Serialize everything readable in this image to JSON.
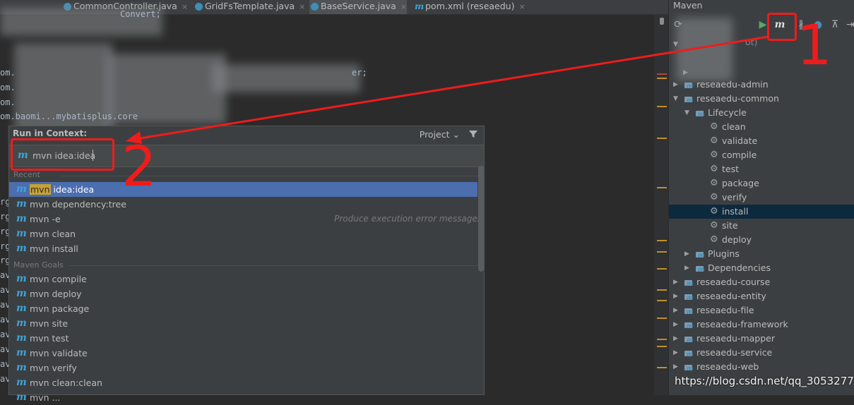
{
  "tabs": [
    {
      "label": "CommonController.java",
      "icon": "class-icon"
    },
    {
      "label": "GridFsTemplate.java",
      "icon": "class-icon"
    },
    {
      "label": "BaseService.java",
      "icon": "class-icon",
      "active": true
    },
    {
      "label": "pom.xml (reseaedu)",
      "icon": "maven-icon"
    }
  ],
  "tab_close": "×",
  "editor": {
    "lines": [
      "Convert;",
      "om.",
      "er;",
      "om.",
      "om.",
      "om.baomi...mybatisplus.core"
    ],
    "gutter_fragments": [
      "rg",
      "rg",
      "rg",
      "rg",
      "rg",
      "rg",
      "av",
      "av",
      "av",
      "av",
      "av",
      "av",
      "av",
      "av",
      "av"
    ]
  },
  "maven": {
    "title": "Maven",
    "root_fragment": "ot)",
    "tree": [
      {
        "label": "reseaedu-admin",
        "level": 0,
        "expanded": false
      },
      {
        "label": "reseaedu-common",
        "level": 0,
        "expanded": true
      },
      {
        "label": "Lifecycle",
        "level": 1,
        "expanded": true
      },
      {
        "label": "clean",
        "level": 2
      },
      {
        "label": "validate",
        "level": 2
      },
      {
        "label": "compile",
        "level": 2
      },
      {
        "label": "test",
        "level": 2
      },
      {
        "label": "package",
        "level": 2
      },
      {
        "label": "verify",
        "level": 2
      },
      {
        "label": "install",
        "level": 2,
        "selected": true
      },
      {
        "label": "site",
        "level": 2
      },
      {
        "label": "deploy",
        "level": 2
      },
      {
        "label": "Plugins",
        "level": 1,
        "expanded": false
      },
      {
        "label": "Dependencies",
        "level": 1,
        "expanded": false
      },
      {
        "label": "reseaedu-course",
        "level": 0,
        "expanded": false
      },
      {
        "label": "reseaedu-entity",
        "level": 0,
        "expanded": false
      },
      {
        "label": "reseaedu-file",
        "level": 0,
        "expanded": false
      },
      {
        "label": "reseaedu-framework",
        "level": 0,
        "expanded": false
      },
      {
        "label": "reseaedu-mapper",
        "level": 0,
        "expanded": false
      },
      {
        "label": "reseaedu-service",
        "level": 0,
        "expanded": false
      },
      {
        "label": "reseaedu-web",
        "level": 0,
        "expanded": false
      }
    ]
  },
  "popup": {
    "title": "Run in Context:",
    "project_label": "Project",
    "input_value": "mvn idea:idea",
    "recent_label": "Recent",
    "goals_label": "Maven Goals",
    "recent": [
      {
        "prefix": "mvn",
        "rest": " idea:idea",
        "selected": true
      },
      {
        "prefix": "",
        "rest": "mvn dependency:tree"
      },
      {
        "prefix": "",
        "rest": "mvn -e",
        "hint": "Produce execution error messages"
      },
      {
        "prefix": "",
        "rest": "mvn clean"
      },
      {
        "prefix": "",
        "rest": "mvn install"
      }
    ],
    "goals": [
      "mvn compile",
      "mvn deploy",
      "mvn package",
      "mvn site",
      "mvn test",
      "mvn validate",
      "mvn verify",
      "mvn clean:clean",
      "mvn ..."
    ]
  },
  "annotations": {
    "label1": "1",
    "label2": "2",
    "color": "#ee1c1c"
  },
  "watermark": "https://blog.csdn.net/qq_30532777",
  "colors": {
    "accent": "#3fa3d8",
    "selection": "#4b6eaf",
    "tree_selection": "#0d293e"
  }
}
